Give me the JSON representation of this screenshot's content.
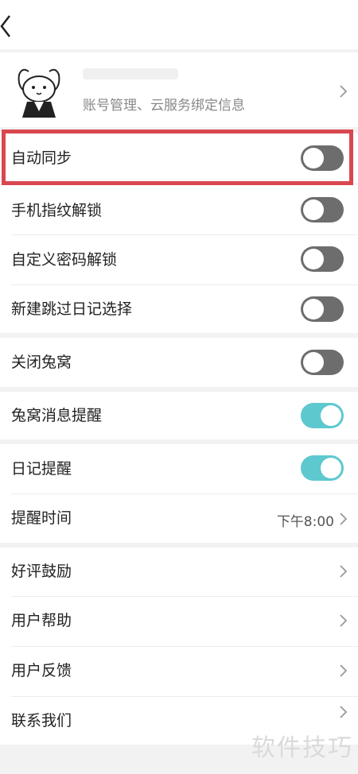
{
  "profile": {
    "subtitle": "账号管理、云服务绑定信息"
  },
  "settings": {
    "auto_sync": {
      "label": "自动同步",
      "on": false
    },
    "fingerprint": {
      "label": "手机指纹解锁",
      "on": false
    },
    "custom_password": {
      "label": "自定义密码解锁",
      "on": false
    },
    "skip_diary_select": {
      "label": "新建跳过日记选择",
      "on": false
    },
    "close_rabbit_nest": {
      "label": "关闭兔窝",
      "on": false
    },
    "rabbit_msg_remind": {
      "label": "兔窝消息提醒",
      "on": true
    },
    "diary_remind": {
      "label": "日记提醒",
      "on": true
    },
    "remind_time": {
      "label": "提醒时间",
      "value": "下午8:00"
    },
    "good_review": {
      "label": "好评鼓励"
    },
    "user_help": {
      "label": "用户帮助"
    },
    "user_feedback": {
      "label": "用户反馈"
    },
    "contact_us": {
      "label": "联系我们"
    }
  },
  "watermark": "软件技巧",
  "colors": {
    "toggle_on": "#5ec8cf",
    "toggle_off": "#6d6d6d",
    "highlight": "#d9474f"
  }
}
